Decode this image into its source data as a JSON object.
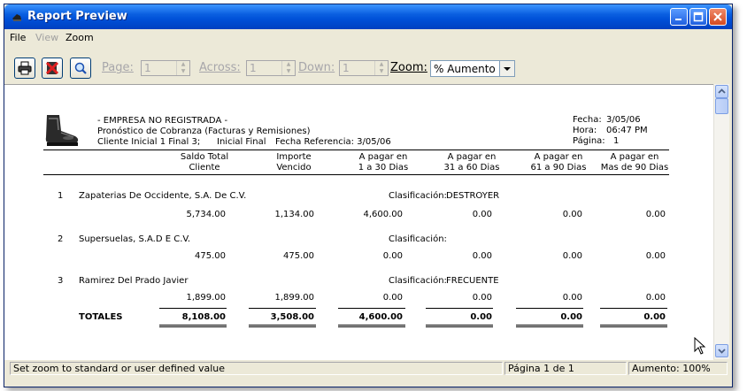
{
  "window": {
    "title": "Report Preview"
  },
  "menu": {
    "file": "File",
    "view": "View",
    "zoom": "Zoom"
  },
  "toolbar": {
    "page_label": "Page:",
    "page_value": "1",
    "across_label": "Across:",
    "across_value": "1",
    "down_label": "Down:",
    "down_value": "1",
    "zoom_label": "Zoom:",
    "zoom_value": "% Aumento"
  },
  "report": {
    "header": {
      "company": "- EMPRESA NO REGISTRADA -",
      "title": "Pronóstico de Cobranza (Facturas y Remisiones)",
      "filter": "Cliente Inicial 1 Final 3;",
      "filter2": "Inicial  Final",
      "ref_date": "Fecha Referencia:  3/05/06",
      "fecha_label": "Fecha:",
      "fecha_value": "3/05/06",
      "hora_label": "Hora:",
      "hora_value": "06:47 PM",
      "pagina_label": "Página:",
      "pagina_value": "1"
    },
    "columns": [
      {
        "l1": "Saldo Total",
        "l2": "Cliente"
      },
      {
        "l1": "Importe",
        "l2": "Vencido"
      },
      {
        "l1": "A pagar en",
        "l2": "1 a 30 Dias"
      },
      {
        "l1": "A pagar en",
        "l2": "31 a 60 Dias"
      },
      {
        "l1": "A pagar en",
        "l2": "61 a 90 Dias"
      },
      {
        "l1": "A pagar en",
        "l2": "Mas de 90 Dias"
      }
    ],
    "clients": [
      {
        "num": "1",
        "name": "Zapaterias De Occidente, S.A. De C.V.",
        "class_label": "Clasificación:",
        "class_value": "DESTROYER",
        "values": [
          "5,734.00",
          "1,134.00",
          "4,600.00",
          "0.00",
          "0.00",
          "0.00"
        ]
      },
      {
        "num": "2",
        "name": "Supersuelas, S.A.D E C.V.",
        "class_label": "Clasificación:",
        "class_value": "",
        "values": [
          "475.00",
          "475.00",
          "0.00",
          "0.00",
          "0.00",
          "0.00"
        ]
      },
      {
        "num": "3",
        "name": "Ramirez Del Prado Javier",
        "class_label": "Clasificación:",
        "class_value": "FRECUENTE",
        "values": [
          "1,899.00",
          "1,899.00",
          "0.00",
          "0.00",
          "0.00",
          "0.00"
        ]
      }
    ],
    "totals": {
      "label": "TOTALES",
      "values": [
        "8,108.00",
        "3,508.00",
        "4,600.00",
        "0.00",
        "0.00",
        "0.00"
      ]
    }
  },
  "status": {
    "hint": "Set zoom to standard or user defined value",
    "page": "Página 1 de 1",
    "zoom": "Aumento: 100%"
  }
}
